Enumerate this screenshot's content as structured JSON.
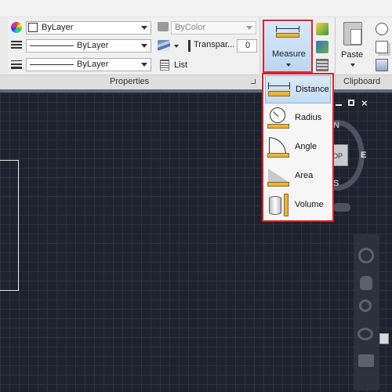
{
  "properties": {
    "color_value": "ByLayer",
    "linetype_value": "ByLayer",
    "lineweight_value": "ByLayer",
    "plot_style_value": "ByColor",
    "transparency_label": "Transpar...",
    "transparency_value": "0",
    "list_label": "List",
    "panel_title": "Properties"
  },
  "measure": {
    "button_label": "Measure",
    "items": [
      {
        "label": "Distance",
        "icon": "distance-icon"
      },
      {
        "label": "Radius",
        "icon": "radius-icon"
      },
      {
        "label": "Angle",
        "icon": "angle-icon"
      },
      {
        "label": "Area",
        "icon": "area-icon"
      },
      {
        "label": "Volume",
        "icon": "volume-icon"
      }
    ],
    "active_index": 0
  },
  "clipboard": {
    "paste_label": "Paste",
    "panel_title": "Clipboard"
  },
  "viewcube": {
    "north": "N",
    "east": "E",
    "south": "S",
    "top_face": "OP"
  },
  "colors": {
    "highlight": "#e0202a",
    "canvas": "#1d232d",
    "ribbon": "#f0f0f0",
    "active_item": "#c3dcf3"
  }
}
